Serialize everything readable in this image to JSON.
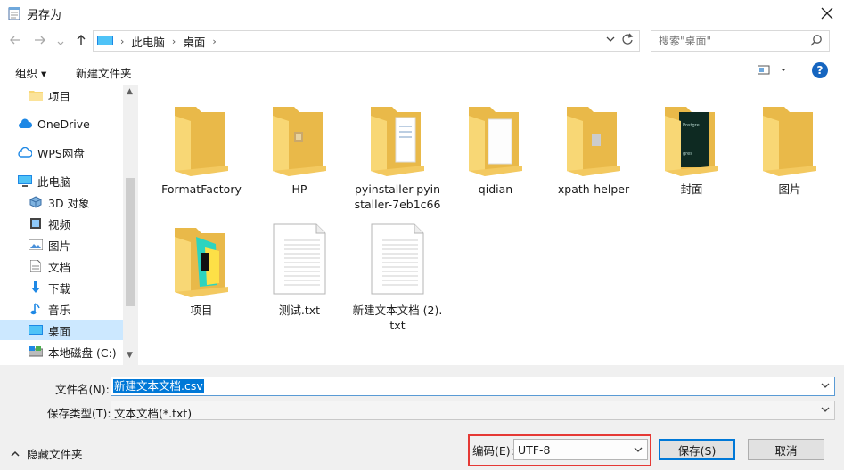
{
  "window": {
    "title": "另存为"
  },
  "nav": {
    "breadcrumb": [
      "此电脑",
      "桌面"
    ],
    "search_placeholder": "搜索\"桌面\""
  },
  "toolbar": {
    "organize": "组织 ▾",
    "new_folder": "新建文件夹"
  },
  "sidebar": {
    "items": [
      {
        "label": "项目",
        "icon": "folder-icon"
      },
      {
        "label": "OneDrive",
        "icon": "cloud-icon"
      },
      {
        "label": "WPS网盘",
        "icon": "wps-cloud-icon"
      },
      {
        "label": "此电脑",
        "icon": "computer-icon"
      },
      {
        "label": "3D 对象",
        "icon": "cube-icon"
      },
      {
        "label": "视频",
        "icon": "video-icon"
      },
      {
        "label": "图片",
        "icon": "picture-icon"
      },
      {
        "label": "文档",
        "icon": "document-icon"
      },
      {
        "label": "下载",
        "icon": "download-icon"
      },
      {
        "label": "音乐",
        "icon": "music-icon"
      },
      {
        "label": "桌面",
        "icon": "desktop-icon"
      },
      {
        "label": "本地磁盘 (C:)",
        "icon": "drive-icon"
      }
    ]
  },
  "files": [
    {
      "name": "FormatFactory",
      "type": "folder"
    },
    {
      "name": "HP",
      "type": "folder"
    },
    {
      "name": "pyinstaller-pyinstaller-7eb1c66",
      "type": "folder"
    },
    {
      "name": "qidian",
      "type": "folder"
    },
    {
      "name": "xpath-helper",
      "type": "folder"
    },
    {
      "name": "封面",
      "type": "folder"
    },
    {
      "name": "图片",
      "type": "folder"
    },
    {
      "name": "项目",
      "type": "folder"
    },
    {
      "name": "测试.txt",
      "type": "text"
    },
    {
      "name": "新建文本文档 (2).txt",
      "type": "text"
    }
  ],
  "form": {
    "filename_label": "文件名(N):",
    "filename_value": "新建文本文档.csv",
    "filetype_label": "保存类型(T):",
    "filetype_value": "文本文档(*.txt)",
    "encoding_label": "编码(E):",
    "encoding_value": "UTF-8",
    "save": "保存(S)",
    "cancel": "取消",
    "hide_folders": "隐藏文件夹"
  },
  "colors": {
    "accent": "#0078d7",
    "highlight": "#e53935",
    "selected": "#cce8ff",
    "folder": "#f8d775"
  }
}
